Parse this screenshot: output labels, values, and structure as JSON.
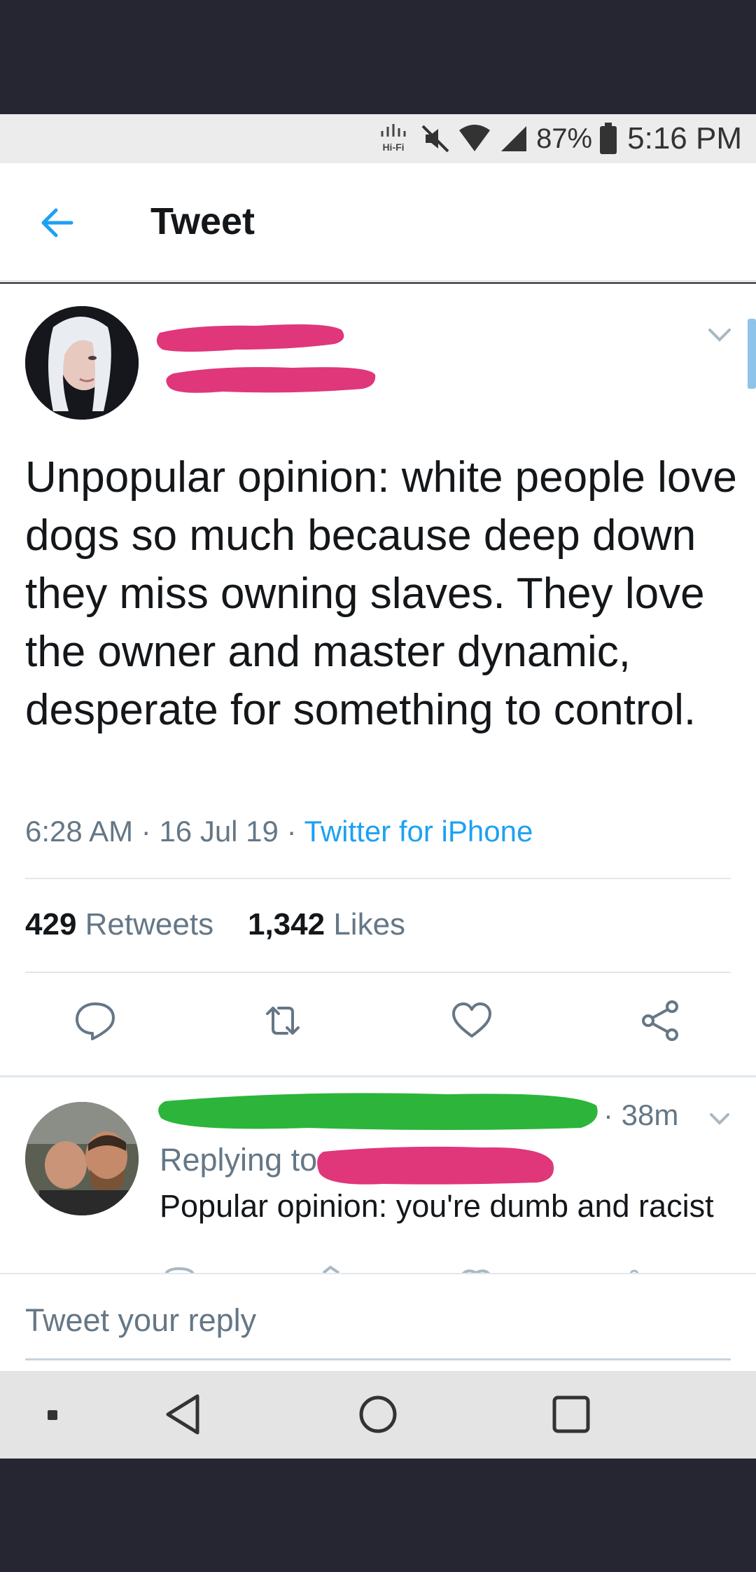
{
  "status_bar": {
    "battery_percent": "87%",
    "time": "5:16 PM",
    "hifi_label": "Hi-Fi",
    "icons": [
      "hifi-icon",
      "mute-icon",
      "wifi-icon",
      "signal-icon",
      "battery-icon"
    ]
  },
  "header": {
    "title": "Tweet"
  },
  "tweet": {
    "text": "Unpopular opinion: white people love dogs so much because deep down they miss owning slaves. They love the owner and master dynamic, desperate for something to control.",
    "time": "6:28 AM",
    "date": "16 Jul 19",
    "source": "Twitter for iPhone",
    "retweets_count": "429",
    "retweets_label": "Retweets",
    "likes_count": "1,342",
    "likes_label": "Likes"
  },
  "reply": {
    "time": "38m",
    "replying_label": "Replying to",
    "text": "Popular opinion:  you're dumb and racist"
  },
  "compose": {
    "placeholder": "Tweet your reply"
  },
  "colors": {
    "accent": "#1da1f2",
    "redaction_pink": "#e0377a",
    "redaction_green": "#2cb53a",
    "frame": "#262633"
  }
}
